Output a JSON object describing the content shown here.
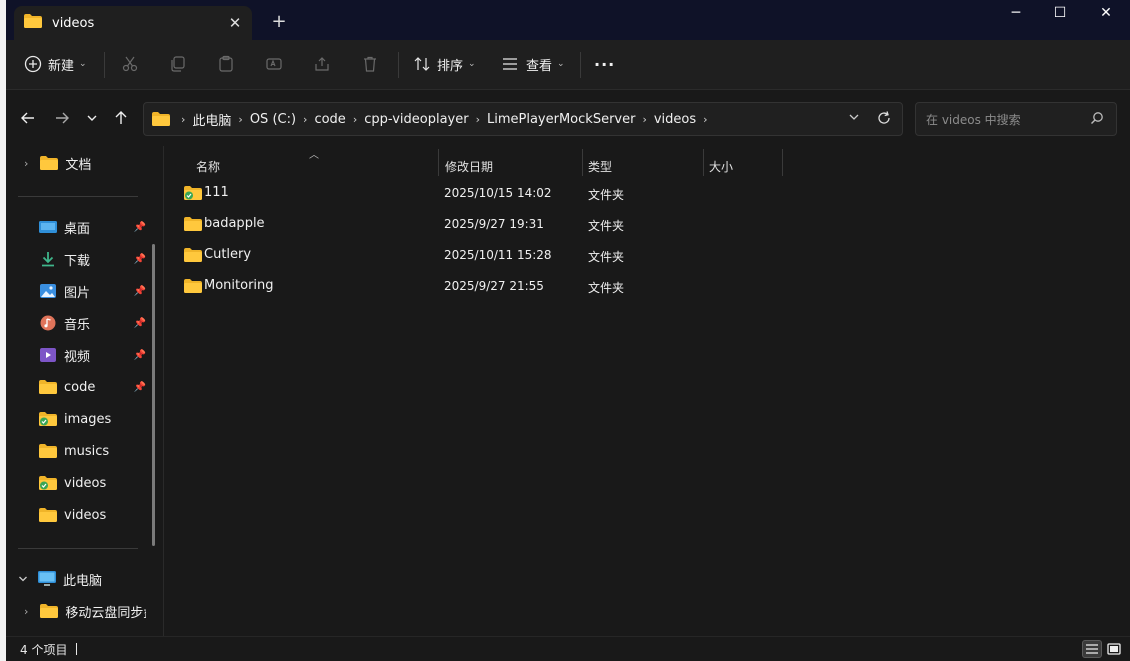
{
  "window": {
    "tab_title": "videos",
    "new_tab_symbol": "+",
    "controls": {
      "minimize": "─",
      "maximize": "☐",
      "close": "✕"
    }
  },
  "toolbar": {
    "new_label": "新建",
    "sort_label": "排序",
    "view_label": "查看",
    "more_label": "···",
    "icons": [
      "cut-icon",
      "copy-icon",
      "paste-icon",
      "rename-icon",
      "share-icon",
      "delete-icon"
    ]
  },
  "address": {
    "crumbs": [
      "此电脑",
      "OS (C:)",
      "code",
      "cpp-videoplayer",
      "LimePlayerMockServer",
      "videos"
    ],
    "search_placeholder": "在 videos 中搜索"
  },
  "sidebar": {
    "top_items": [
      {
        "label": "文档",
        "icon": "documents-folder-icon",
        "pinned": false
      }
    ],
    "quick_items": [
      {
        "label": "桌面",
        "icon": "desktop-icon",
        "pinned": true
      },
      {
        "label": "下载",
        "icon": "download-icon",
        "pinned": true
      },
      {
        "label": "图片",
        "icon": "pictures-icon",
        "pinned": true
      },
      {
        "label": "音乐",
        "icon": "music-icon",
        "pinned": true
      },
      {
        "label": "视频",
        "icon": "videos-icon",
        "pinned": true
      },
      {
        "label": "code",
        "icon": "folder-icon",
        "pinned": true
      },
      {
        "label": "images",
        "icon": "folder-synced-icon",
        "pinned": false
      },
      {
        "label": "musics",
        "icon": "folder-icon",
        "pinned": false
      },
      {
        "label": "videos",
        "icon": "folder-synced-icon",
        "pinned": false
      },
      {
        "label": "videos",
        "icon": "folder-icon",
        "pinned": false
      }
    ],
    "this_pc": {
      "label": "此电脑",
      "icon": "computer-icon"
    },
    "cloud": {
      "label": "移动云盘同步盘",
      "icon": "folder-icon"
    }
  },
  "filelist": {
    "columns": [
      "名称",
      "修改日期",
      "类型",
      "大小"
    ],
    "rows": [
      {
        "name": "111",
        "date": "2025/10/15 14:02",
        "type": "文件夹",
        "size": "",
        "synced": true
      },
      {
        "name": "badapple",
        "date": "2025/9/27 19:31",
        "type": "文件夹",
        "size": "",
        "synced": false
      },
      {
        "name": "Cutlery",
        "date": "2025/10/11 15:28",
        "type": "文件夹",
        "size": "",
        "synced": false
      },
      {
        "name": "Monitoring",
        "date": "2025/9/27 21:55",
        "type": "文件夹",
        "size": "",
        "synced": false
      }
    ]
  },
  "status": {
    "item_count": "4 个项目"
  },
  "colors": {
    "folder": "#f0b429",
    "sync_badge": "#3aa655",
    "accent": "#60cdff"
  }
}
